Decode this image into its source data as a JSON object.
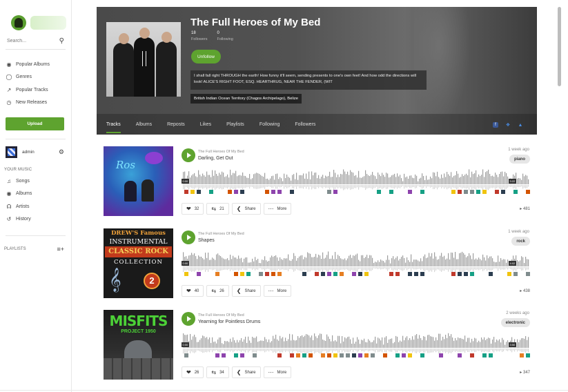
{
  "sidebar": {
    "search_placeholder": "Search...",
    "nav": [
      {
        "label": "Popular Albums",
        "icon": "record-icon"
      },
      {
        "label": "Genres",
        "icon": "tag-icon"
      },
      {
        "label": "Popular Tracks",
        "icon": "trending-icon"
      },
      {
        "label": "New Releases",
        "icon": "clock-icon"
      }
    ],
    "upload_label": "Upload",
    "user_name": "admin",
    "your_music_label": "YOUR MUSIC",
    "music_items": [
      {
        "label": "Songs",
        "icon": "note-icon"
      },
      {
        "label": "Albums",
        "icon": "record-icon"
      },
      {
        "label": "Artists",
        "icon": "mic-icon"
      },
      {
        "label": "History",
        "icon": "history-icon"
      }
    ],
    "playlists_label": "PLAYLISTS"
  },
  "artist": {
    "name": "The Full Heroes of My Bed",
    "followers_count": "18",
    "followers_label": "Followers",
    "following_count": "0",
    "following_label": "Following",
    "unfollow_label": "Unfollow",
    "bio": "I shall fall right THROUGH the earth! How funny it'll seem, sending presents to one's own feet! And how odd the directions will look! ALICE'S RIGHT FOOT, ESQ. HEARTHRUG, NEAR THE FENDER, (WIT",
    "location": "British Indian Ocean Territory (Chagos Archipelago), Belize",
    "tabs": [
      "Tracks",
      "Albums",
      "Reposts",
      "Likes",
      "Playlists",
      "Following",
      "Followers"
    ]
  },
  "tracks": [
    {
      "artist": "The Full Heroes Of My Bed",
      "title": "Darling, Get Out",
      "time_ago": "1 week ago",
      "tag": "piano",
      "duration_start": "0:00",
      "duration_end": "3:22",
      "likes": "32",
      "reposts": "21",
      "share_label": "Share",
      "more_label": "More",
      "plays": "481",
      "cover_text": "Rosie Sedgwick"
    },
    {
      "artist": "The Full Heroes Of My Bed",
      "title": "Shapes",
      "time_ago": "1 week ago",
      "tag": "rock",
      "duration_start": "0:00",
      "duration_end": "4:02",
      "likes": "40",
      "reposts": "26",
      "share_label": "Share",
      "more_label": "More",
      "plays": "438",
      "cover_line1": "DREW'S Famous",
      "cover_line2": "INSTRUMENTAL",
      "cover_line3": "CLASSIC ROCK",
      "cover_line4": "COLLECTION",
      "cover_vol": "2"
    },
    {
      "artist": "The Full Heroes Of My Bed",
      "title": "Yearning for Pointless Drums",
      "time_ago": "2 weeks ago",
      "tag": "electronic",
      "duration_start": "0:00",
      "duration_end": "3:50",
      "likes": "26",
      "reposts": "34",
      "share_label": "Share",
      "more_label": "More",
      "plays": "347",
      "cover_text": "MISFITS",
      "cover_sub": "PROJECT 1950"
    }
  ]
}
